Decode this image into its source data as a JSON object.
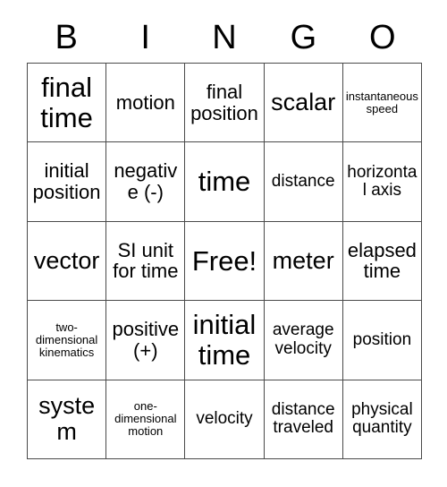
{
  "header": {
    "letters": [
      "B",
      "I",
      "N",
      "G",
      "O"
    ]
  },
  "grid": {
    "rows": 5,
    "columns": 5,
    "border_color": "#4a4a4a",
    "background_color": "#ffffff",
    "text_color": "#000000",
    "cells": [
      {
        "text": "final time",
        "size": "fs-xl"
      },
      {
        "text": "motion",
        "size": "fs-md"
      },
      {
        "text": "final position",
        "size": "fs-md"
      },
      {
        "text": "scalar",
        "size": "fs-lg"
      },
      {
        "text": "instantaneous speed",
        "size": "fs-xxs"
      },
      {
        "text": "initial position",
        "size": "fs-md"
      },
      {
        "text": "negative (-)",
        "size": "fs-md"
      },
      {
        "text": "time",
        "size": "fs-xl"
      },
      {
        "text": "distance",
        "size": "fs-sm"
      },
      {
        "text": "horizontal axis",
        "size": "fs-sm"
      },
      {
        "text": "vector",
        "size": "fs-lg"
      },
      {
        "text": "SI unit for time",
        "size": "fs-md"
      },
      {
        "text": "Free!",
        "size": "fs-xl"
      },
      {
        "text": "meter",
        "size": "fs-lg"
      },
      {
        "text": "elapsed time",
        "size": "fs-md"
      },
      {
        "text": "two-dimensional kinematics",
        "size": "fs-xxs"
      },
      {
        "text": "positive (+)",
        "size": "fs-md"
      },
      {
        "text": "initial time",
        "size": "fs-xl"
      },
      {
        "text": "average velocity",
        "size": "fs-sm"
      },
      {
        "text": "position",
        "size": "fs-sm"
      },
      {
        "text": "system",
        "size": "fs-lg"
      },
      {
        "text": "one-dimensional motion",
        "size": "fs-xxs"
      },
      {
        "text": "velocity",
        "size": "fs-sm"
      },
      {
        "text": "distance traveled",
        "size": "fs-sm"
      },
      {
        "text": "physical quantity",
        "size": "fs-sm"
      }
    ]
  }
}
